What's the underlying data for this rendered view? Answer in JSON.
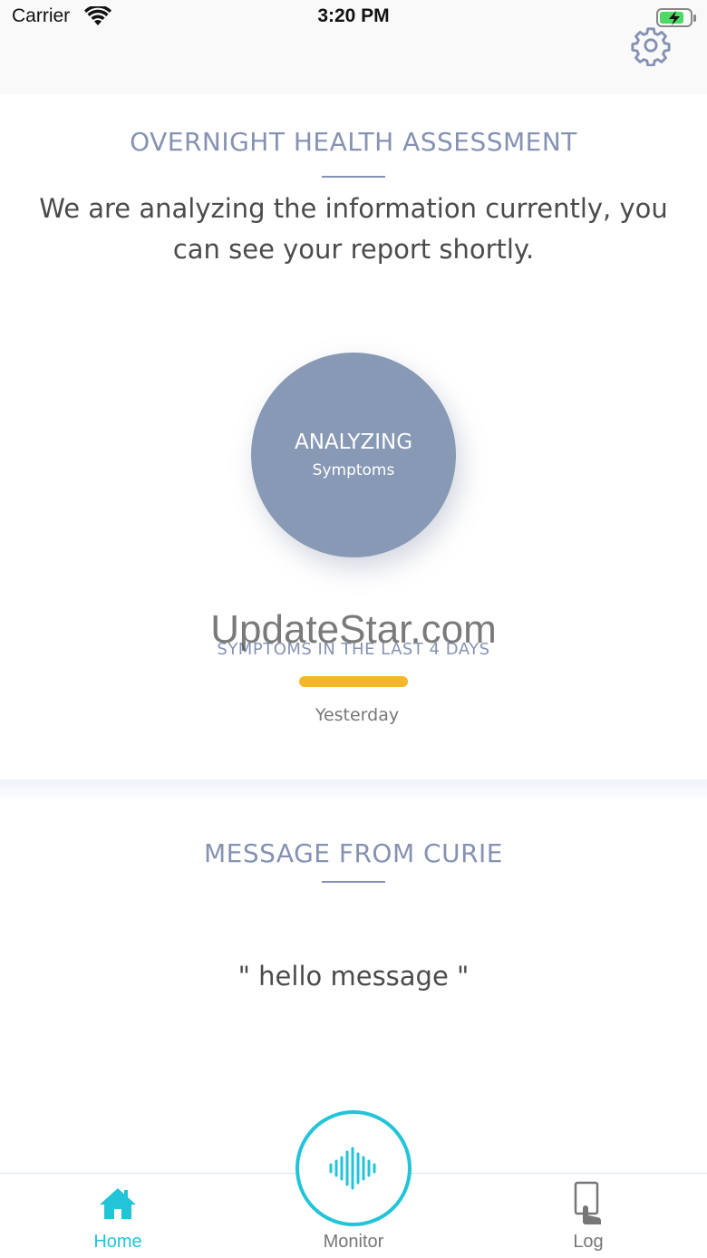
{
  "status_bar": {
    "carrier": "Carrier",
    "time": "3:20 PM",
    "wifi_icon": "wifi-icon",
    "battery_icon": "battery-charging-icon"
  },
  "header": {
    "settings_icon": "gear-icon"
  },
  "assessment": {
    "title": "OVERNIGHT HEALTH ASSESSMENT",
    "intro_line1": "We are analyzing the information currently, you",
    "intro_line2": "can see your report shortly.",
    "circle_main": "ANALYZING",
    "circle_sub": "Symptoms",
    "symptoms_label": "SYMPTOMS IN THE LAST 4 DAYS",
    "day_label": "Yesterday"
  },
  "watermark": "UpdateStar.com",
  "message_section": {
    "title": "MESSAGE FROM CURIE",
    "message": "\" hello message \""
  },
  "tabbar": {
    "home_label": "Home",
    "monitor_label": "Monitor",
    "log_label": "Log"
  },
  "colors": {
    "accent_title": "#8592b2",
    "circle": "#8899b6",
    "active_tab": "#22c4d8",
    "inactive_tab": "#777777",
    "symptom_bar": "#f4b729"
  }
}
